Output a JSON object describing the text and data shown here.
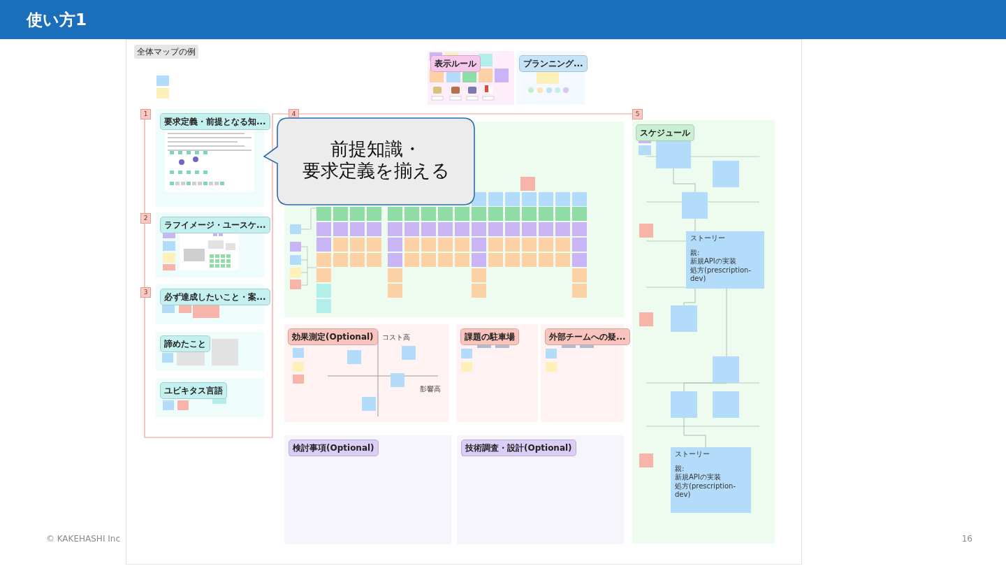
{
  "slide": {
    "title": "使い方1",
    "footer": "© KAKEHASHI Inc",
    "page_number": "16"
  },
  "board": {
    "label": "全体マップの例",
    "legend_frames": [
      {
        "title": "表示ルール",
        "kind": "rules",
        "color": "#f6c8ec"
      },
      {
        "title": "プランニング...",
        "kind": "planning",
        "color": "#c6e3f8"
      }
    ],
    "steps": [
      "1",
      "2",
      "3",
      "4",
      "5"
    ],
    "sections": [
      {
        "title": "要求定義・前提となる知...",
        "kind": "document",
        "color": "#c4f1ef"
      },
      {
        "title": "ラフイメージ・ユースケ...",
        "kind": "sketch",
        "color": "#c4f1ef"
      },
      {
        "title": "必ず達成したいこと・案...",
        "kind": "notes",
        "color": "#c4f1ef"
      },
      {
        "title": "諦めたこと",
        "kind": "notes",
        "color": "#c4f1ef"
      },
      {
        "title": "ユビキタス言語",
        "kind": "notes",
        "color": "#c4f1ef"
      },
      {
        "title": "課題の駐車場",
        "kind": "parking",
        "color": "#f9c4bd"
      },
      {
        "title": "外部チームへの疑...",
        "kind": "parking",
        "color": "#f9c4bd"
      },
      {
        "title": "検討事項(Optional)",
        "kind": "empty",
        "color": "#dccdf6"
      },
      {
        "title": "技術調査・設計(Optional)",
        "kind": "empty",
        "color": "#dccdf6"
      }
    ],
    "impact_matrix": {
      "title": "効果測定(Optional)",
      "color": "#f9c4bd",
      "y_axis": "コスト高",
      "x_axis": "影響高"
    },
    "callout": {
      "lines": [
        "前提知識・",
        "要求定義を揃える"
      ]
    },
    "schedule": {
      "title": "スケジュール",
      "color": "#c9efd2",
      "stories": [
        {
          "heading": "ストーリー",
          "parent_label": "親:",
          "parent_name": "新規APIの実装",
          "project": "処方(prescription-dev)"
        },
        {
          "heading": "ストーリー",
          "parent_label": "親:",
          "parent_name": "新規APIの実装",
          "project": "処方(prescription-dev)"
        }
      ]
    }
  }
}
